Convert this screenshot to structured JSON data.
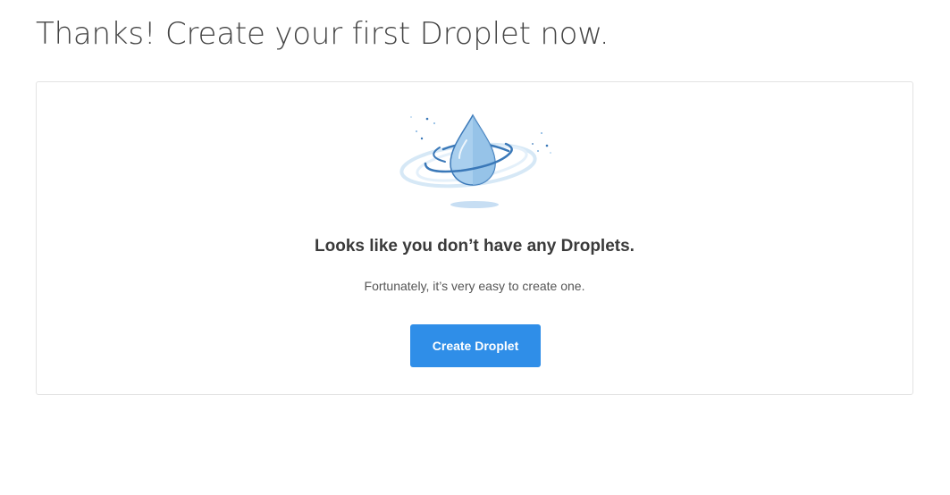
{
  "page": {
    "title": "Thanks! Create your first Droplet now."
  },
  "empty_state": {
    "illustration_icon": "droplet-illustration-icon",
    "heading": "Looks like you don’t have any Droplets.",
    "subtext": "Fortunately, it’s very easy to create one.",
    "button_label": "Create Droplet"
  },
  "colors": {
    "accent": "#2f8ee8",
    "droplet_light": "#a9cfee",
    "droplet_dark": "#3a78b8",
    "ring_light": "#d6e8f6",
    "border": "#e3e3e3"
  }
}
